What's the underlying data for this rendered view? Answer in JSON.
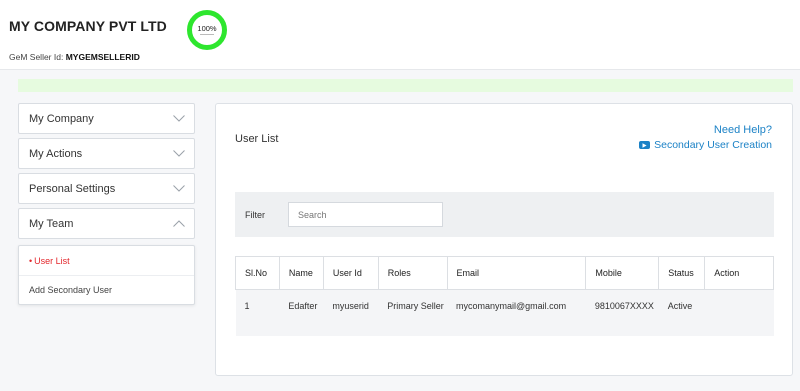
{
  "header": {
    "company_name": "MY COMPANY PVT LTD",
    "seller_id_label": "GeM Seller Id:",
    "seller_id_value": "MYGEMSELLERID",
    "profile_completion": "100%"
  },
  "sidebar": {
    "items": [
      {
        "label": "My Company",
        "expanded": false
      },
      {
        "label": "My Actions",
        "expanded": false
      },
      {
        "label": "Personal Settings",
        "expanded": false
      },
      {
        "label": "My Team",
        "expanded": true
      }
    ],
    "team_submenu": [
      {
        "label": "User List",
        "active": true
      },
      {
        "label": "Add Secondary User",
        "active": false
      }
    ]
  },
  "panel": {
    "title": "User List",
    "help_title": "Need Help?",
    "help_link": "Secondary User Creation",
    "filter_label": "Filter",
    "search_placeholder": "Search"
  },
  "table": {
    "headers": [
      "Sl.No",
      "Name",
      "User Id",
      "Roles",
      "Email",
      "Mobile",
      "Status",
      "Action"
    ],
    "rows": [
      {
        "sl": "1",
        "name": "Edafter",
        "user_id": "myuserid",
        "roles": "Primary Seller",
        "email": "mycomanymail@gmail.com",
        "mobile": "9810067XXXX",
        "status": "Active",
        "action": ""
      }
    ]
  },
  "colors": {
    "accent": "#1c82c6",
    "progress": "#2ee62e",
    "active_menu": "#e3262b",
    "banner": "#e6fbdf"
  }
}
